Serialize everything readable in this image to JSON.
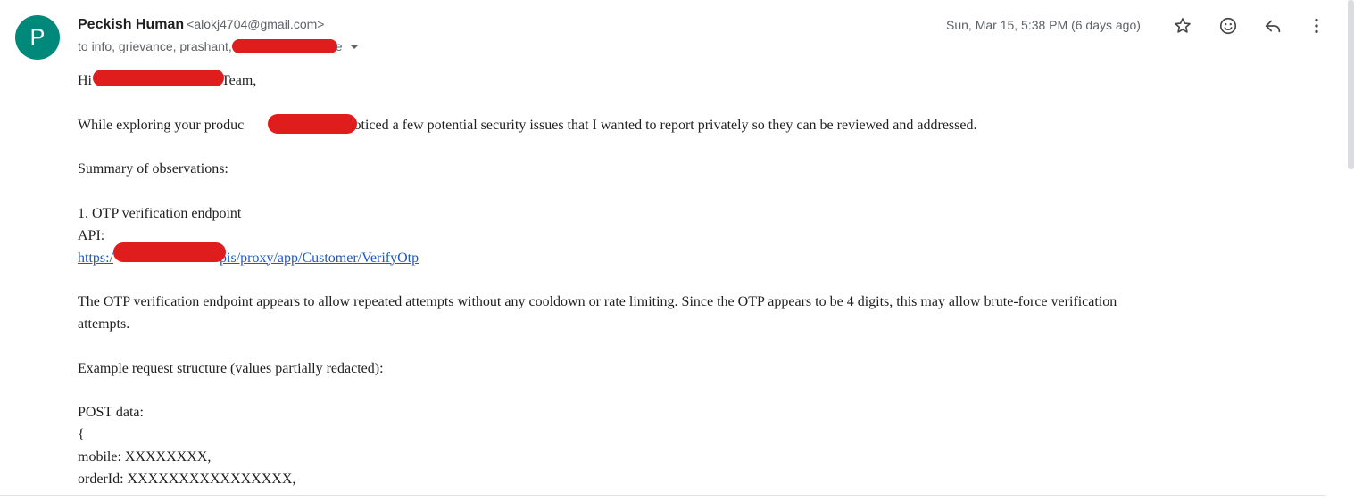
{
  "sender": {
    "avatar_letter": "P",
    "name": "Peckish Human",
    "email": "<alokj4704@gmail.com>",
    "recipients_prefix": "to info, grievance, prashant,",
    "recipients_suffix": "e"
  },
  "header": {
    "date": "Sun, Mar 15, 5:38 PM (6 days ago)",
    "icons": [
      "star-icon",
      "emoji-icon",
      "reply-icon",
      "more-vert-icon"
    ]
  },
  "body": {
    "greeting_start": "Hi",
    "greeting_end": "Team,",
    "intro_start": "While exploring your produc",
    "intro_end": ", I noticed a few potential security issues that I wanted to report privately so they can be reviewed and addressed.",
    "summary": "Summary of observations:",
    "item1_title": "1. OTP verification endpoint",
    "api_label": "API:",
    "api_link_start": "https:/",
    "api_link_end": "pis/proxy/app/Customer/VerifyOtp",
    "description_line1": "The OTP verification endpoint appears to allow repeated attempts without any cooldown or rate limiting. Since the OTP appears to be 4 digits, this may allow brute-force verification",
    "description_line2": "attempts.",
    "example_heading": "Example request structure (values partially redacted):",
    "post_label": "POST data:",
    "brace_open": "{",
    "mobile_line": "mobile: XXXXXXXX,",
    "order_line": "orderId: XXXXXXXXXXXXXXXX,"
  },
  "colors": {
    "avatar_bg": "#00897b",
    "redaction": "#e01d1d",
    "link": "#1a58c4"
  }
}
